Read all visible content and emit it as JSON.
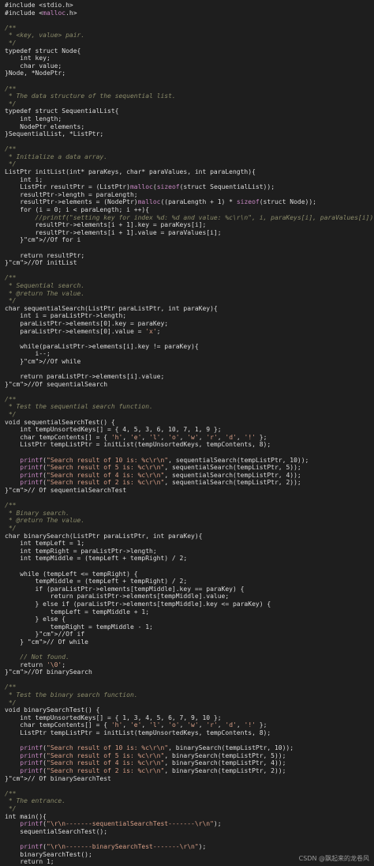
{
  "code_lines": [
    "#include <stdio.h>",
    "#include <malloc.h>",
    "",
    "/**",
    " * <key, value> pair.",
    " */",
    "typedef struct Node{",
    "    int key;",
    "    char value;",
    "}Node, *NodePtr;",
    "",
    "/**",
    " * The data structure of the sequential list.",
    " */",
    "typedef struct SequentialList{",
    "    int length;",
    "    NodePtr elements;",
    "}SequentialList, *ListPtr;",
    "",
    "/**",
    " * Initialize a data array.",
    " */",
    "ListPtr initList(int* paraKeys, char* paraValues, int paraLength){",
    "    int i;",
    "    ListPtr resultPtr = (ListPtr)malloc(sizeof(struct SequentialList));",
    "    resultPtr->length = paraLength;",
    "    resultPtr->elements = (NodePtr)malloc((paraLength + 1) * sizeof(struct Node));",
    "    for (i = 0; i < paraLength; i ++){",
    "        //printf(\"setting key for index %d: %d and value: %c\\r\\n\", i, paraKeys[i], paraValues[i]);",
    "        resultPtr->elements[i + 1].key = paraKeys[i];",
    "        resultPtr->elements[i + 1].value = paraValues[i];",
    "    }//Of for i",
    "",
    "    return resultPtr;",
    "}//Of initList",
    "",
    "/**",
    " * Sequential search.",
    " * @return The value.",
    " */",
    "char sequentialSearch(ListPtr paraListPtr, int paraKey){",
    "    int i = paraListPtr->length;",
    "    paraListPtr->elements[0].key = paraKey;",
    "    paraListPtr->elements[0].value = 'x';",
    "",
    "    while(paraListPtr->elements[i].key != paraKey){",
    "        i--;",
    "    }//Of while",
    "",
    "    return paraListPtr->elements[i].value;",
    "}//Of sequentialSearch",
    "",
    "/**",
    " * Test the sequential search function.",
    " */",
    "void sequentialSearchTest() {",
    "    int tempUnsortedKeys[] = { 4, 5, 3, 6, 10, 7, 1, 9 };",
    "    char tempContents[] = { 'h', 'e', 'l', 'o', 'w', 'r', 'd', '!' };",
    "    ListPtr tempListPtr = initList(tempUnsortedKeys, tempContents, 8);",
    "",
    "    printf(\"Search result of 10 is: %c\\r\\n\", sequentialSearch(tempListPtr, 10));",
    "    printf(\"Search result of 5 is: %c\\r\\n\", sequentialSearch(tempListPtr, 5));",
    "    printf(\"Search result of 4 is: %c\\r\\n\", sequentialSearch(tempListPtr, 4));",
    "    printf(\"Search result of 2 is: %c\\r\\n\", sequentialSearch(tempListPtr, 2));",
    "}// Of sequentialSearchTest",
    "",
    "/**",
    " * Binary search.",
    " * @return The value.",
    " */",
    "char binarySearch(ListPtr paraListPtr, int paraKey){",
    "    int tempLeft = 1;",
    "    int tempRight = paraListPtr->length;",
    "    int tempMiddle = (tempLeft + tempRight) / 2;",
    "",
    "    while (tempLeft <= tempRight) {",
    "        tempMiddle = (tempLeft + tempRight) / 2;",
    "        if (paraListPtr->elements[tempMiddle].key == paraKey) {",
    "            return paraListPtr->elements[tempMiddle].value;",
    "        } else if (paraListPtr->elements[tempMiddle].key <= paraKey) {",
    "            tempLeft = tempMiddle + 1;",
    "        } else {",
    "            tempRight = tempMiddle - 1;",
    "        }//Of if",
    "    } // Of while",
    "",
    "    // Not found.",
    "    return '\\0';",
    "}//Of binarySearch",
    "",
    "/**",
    " * Test the binary search function.",
    " */",
    "void binarySearchTest() {",
    "    int tempUnsortedKeys[] = { 1, 3, 4, 5, 6, 7, 9, 10 };",
    "    char tempContents[] = { 'h', 'e', 'l', 'o', 'w', 'r', 'd', '!' };",
    "    ListPtr tempListPtr = initList(tempUnsortedKeys, tempContents, 8);",
    "",
    "    printf(\"Search result of 10 is: %c\\r\\n\", binarySearch(tempListPtr, 10));",
    "    printf(\"Search result of 5 is: %c\\r\\n\", binarySearch(tempListPtr, 5));",
    "    printf(\"Search result of 4 is: %c\\r\\n\", binarySearch(tempListPtr, 4));",
    "    printf(\"Search result of 2 is: %c\\r\\n\", binarySearch(tempListPtr, 2));",
    "}// Of binarySearchTest",
    "",
    "/**",
    " * The entrance.",
    " */",
    "int main(){",
    "    printf(\"\\r\\n-------sequentialSearchTest-------\\r\\n\");",
    "    sequentialSearchTest();",
    "",
    "    printf(\"\\r\\n-------binarySearchTest-------\\r\\n\");",
    "    binarySearchTest();",
    "    return 1;",
    "}// Of main"
  ],
  "watermark": "CSDN @飘起来的龙卷风",
  "colors": {
    "background": "#1e1e1e",
    "text": "#dcdcdc",
    "comment": "#8b8b6a",
    "macro": "#c586c0",
    "string": "#d69d85",
    "number": "#b5cea8"
  }
}
